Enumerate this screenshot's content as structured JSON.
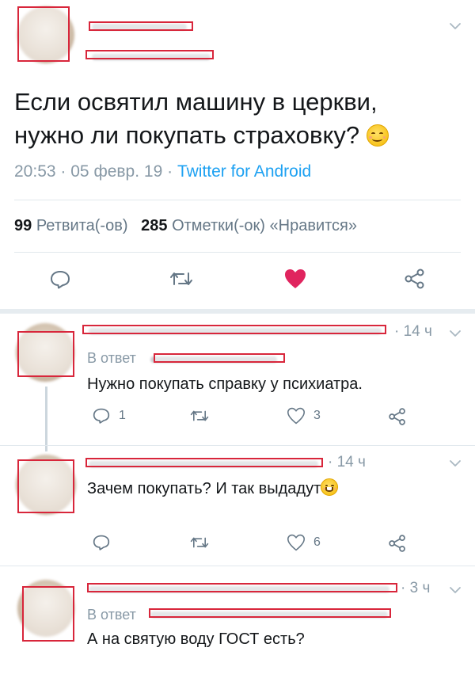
{
  "tweet": {
    "text_line1": "Если освятил машину в церкви,",
    "text_line2": "нужно ли покупать страховку?",
    "time": "20:53",
    "date": "05 февр. 19",
    "separator": "·",
    "source": "Twitter for Android",
    "retweets_count": "99",
    "retweets_label": "Ретвита(-ов)",
    "likes_count": "285",
    "likes_label": "Отметки(-ок) «Нравится»",
    "liked": true
  },
  "colors": {
    "accent": "#1da1f2",
    "like": "#e0245e",
    "redaction": "#d8263b",
    "muted": "#8899a6"
  },
  "replies": [
    {
      "time": "14 ч",
      "replying_prefix": "В ответ",
      "text": "Нужно покупать справку у психиатра.",
      "reply_count": "1",
      "like_count": "3"
    },
    {
      "time": "14 ч",
      "text": "Зачем покупать? И так выдадут",
      "like_count": "6"
    },
    {
      "time": "3 ч",
      "replying_prefix": "В ответ",
      "text": "А на святую воду ГОСТ есть?"
    }
  ],
  "icons": [
    "chevron-down-icon",
    "reply-icon",
    "retweet-icon",
    "heart-icon",
    "share-icon",
    "smiling-emoji"
  ]
}
